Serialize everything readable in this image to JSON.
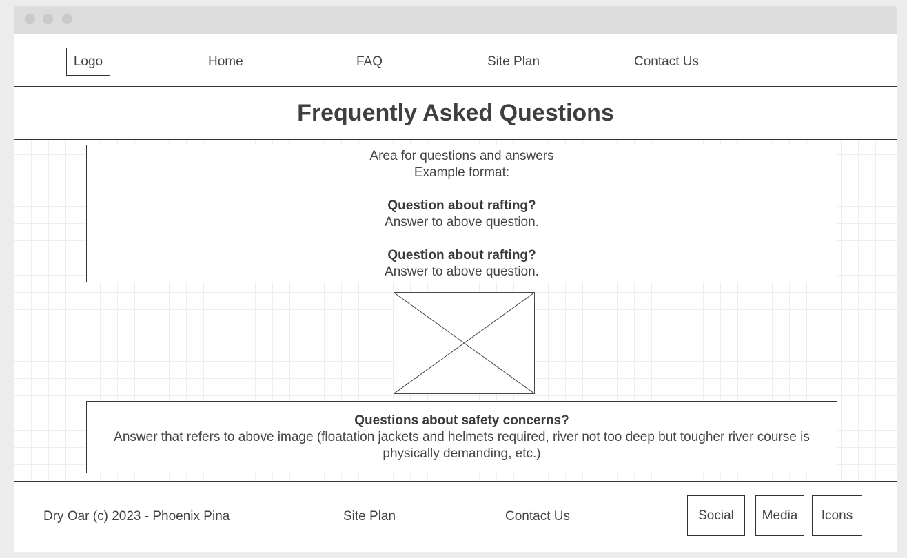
{
  "header": {
    "logo_label": "Logo",
    "nav": [
      {
        "label": "Home"
      },
      {
        "label": "FAQ"
      },
      {
        "label": "Site Plan"
      },
      {
        "label": "Contact Us"
      }
    ]
  },
  "title": "Frequently Asked Questions",
  "faq_area": {
    "intro_line1": "Area for questions and answers",
    "intro_line2": "Example format:",
    "items": [
      {
        "question": "Question about rafting?",
        "answer": "Answer to above question."
      },
      {
        "question": "Question about rafting?",
        "answer": "Answer to above question."
      }
    ]
  },
  "image_placeholder": {
    "icon": "image-placeholder-icon"
  },
  "safety": {
    "question": "Questions about safety concerns?",
    "answer": "Answer that refers to above image (floatation jackets and helmets required, river not too deep but tougher river course is physically demanding, etc.)"
  },
  "footer": {
    "copyright": "Dry Oar (c) 2023 - Phoenix Pina",
    "links": [
      {
        "label": "Site Plan"
      },
      {
        "label": "Contact Us"
      }
    ],
    "social": [
      {
        "label": "Social"
      },
      {
        "label": "Media"
      },
      {
        "label": "Icons"
      }
    ]
  }
}
